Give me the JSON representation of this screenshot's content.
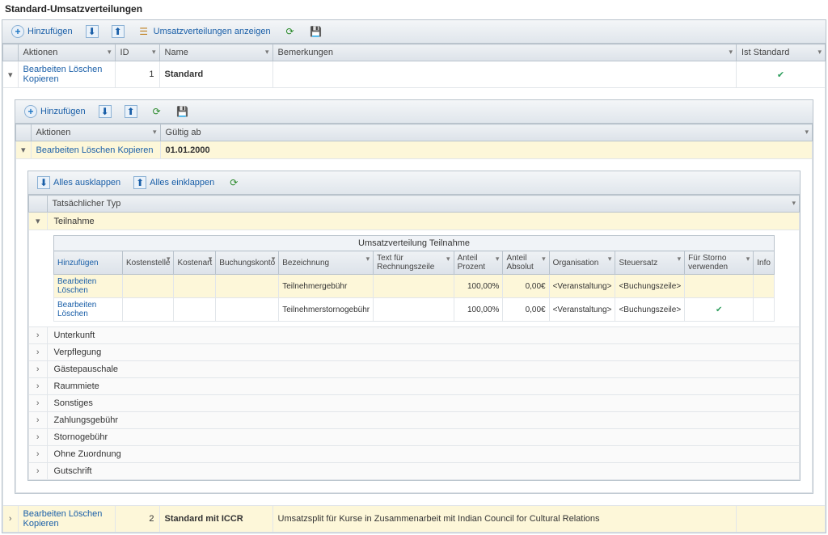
{
  "title": "Standard-Umsatzverteilungen",
  "toolbar": {
    "add": "Hinzufügen",
    "showDistributions": "Umsatzverteilungen anzeigen"
  },
  "mainGrid": {
    "headers": {
      "actions": "Aktionen",
      "id": "ID",
      "name": "Name",
      "remarks": "Bemerkungen",
      "isStandard": "Ist Standard"
    },
    "rows": [
      {
        "actions": [
          "Bearbeiten",
          "Löschen",
          "Kopieren"
        ],
        "id": "1",
        "name": "Standard",
        "remarks": "",
        "isStandard": true,
        "expanded": true
      },
      {
        "actions": [
          "Bearbeiten",
          "Löschen",
          "Kopieren"
        ],
        "id": "2",
        "name": "Standard mit ICCR",
        "remarks": "Umsatzsplit für Kurse in Zusammenarbeit mit Indian Council for Cultural Relations",
        "isStandard": false,
        "expanded": false
      }
    ]
  },
  "innerToolbar": {
    "add": "Hinzufügen"
  },
  "innerGrid": {
    "headers": {
      "actions": "Aktionen",
      "validFrom": "Gültig ab"
    },
    "rows": [
      {
        "actions": [
          "Bearbeiten",
          "Löschen",
          "Kopieren"
        ],
        "validFrom": "01.01.2000"
      }
    ]
  },
  "expandToolbar": {
    "expandAll": "Alles ausklappen",
    "collapseAll": "Alles einklappen"
  },
  "typeHeader": "Tatsächlicher Typ",
  "categories": [
    {
      "name": "Teilnahme",
      "expanded": true
    },
    {
      "name": "Unterkunft",
      "expanded": false
    },
    {
      "name": "Verpflegung",
      "expanded": false
    },
    {
      "name": "Gästepauschale",
      "expanded": false
    },
    {
      "name": "Raummiete",
      "expanded": false
    },
    {
      "name": "Sonstiges",
      "expanded": false
    },
    {
      "name": "Zahlungsgebühr",
      "expanded": false
    },
    {
      "name": "Stornogebühr",
      "expanded": false
    },
    {
      "name": "Ohne Zuordnung",
      "expanded": false
    },
    {
      "name": "Gutschrift",
      "expanded": false
    }
  ],
  "distTitle": "Umsatzverteilung Teilnahme",
  "distHeaders": {
    "add": "Hinzufügen",
    "kostenstelle": "Kostenstelle",
    "kostenart": "Kostenart",
    "buchungskonto": "Buchungskonto",
    "bezeichnung": "Bezeichnung",
    "textRechnung": "Text für Rechnungszeile",
    "anteilProzent": "Anteil Prozent",
    "anteilAbsolut": "Anteil Absolut",
    "organisation": "Organisation",
    "steuersatz": "Steuersatz",
    "storno": "Für Storno verwenden",
    "info": "Info"
  },
  "distRows": [
    {
      "actions": [
        "Bearbeiten",
        "Löschen"
      ],
      "kostenstelle": "",
      "kostenart": "",
      "buchungskonto": "",
      "bezeichnung": "Teilnehmergebühr",
      "text": "",
      "prozent": "100,00%",
      "absolut": "0,00€",
      "org": "<Veranstaltung>",
      "steuer": "<Buchungszeile>",
      "storno": false
    },
    {
      "actions": [
        "Bearbeiten",
        "Löschen"
      ],
      "kostenstelle": "",
      "kostenart": "",
      "buchungskonto": "",
      "bezeichnung": "Teilnehmerstornogebühr",
      "text": "",
      "prozent": "100,00%",
      "absolut": "0,00€",
      "org": "<Veranstaltung>",
      "steuer": "<Buchungszeile>",
      "storno": true
    }
  ]
}
